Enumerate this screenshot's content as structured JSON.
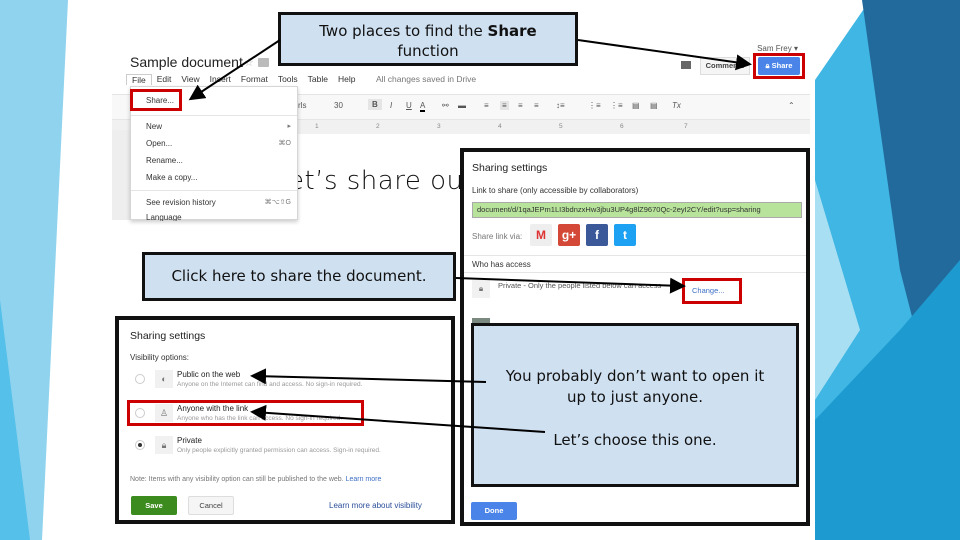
{
  "colors": {
    "callout_fill": "#cfe0f1",
    "highlight_red": "#cc0000",
    "share_blue": "#4a84e8",
    "save_green": "#3b8b1e",
    "link_field_green": "#b7e39a",
    "bg_light_blue": "#8fd3ee",
    "bg_mid_blue": "#3fb6e3",
    "bg_dark_blue": "#236a9c"
  },
  "callouts": {
    "top_line1_prefix": "Two places to find the ",
    "top_line1_bold": "Share",
    "top_line2": "function",
    "click_here": "Click here to share the document.",
    "right_line1": "You probably don’t want to open it",
    "right_line2": "up to just anyone.",
    "right_line3": "Let’s choose this one."
  },
  "gdoc": {
    "title": "Sample document",
    "user": "Sam Frey ▾",
    "menu": [
      "File",
      "Edit",
      "View",
      "Insert",
      "Format",
      "Tools",
      "Table",
      "Help"
    ],
    "saved_status": "All changes saved in Drive",
    "comments_label": "Comments",
    "share_label": "Share",
    "toolbar": {
      "font": "Girls",
      "size": "30",
      "bold": "B",
      "italic": "I",
      "underline": "U",
      "text_color": "A",
      "clear_format": "Tx",
      "collapse": "⌃"
    },
    "ruler_marks": [
      "1",
      "2",
      "3",
      "4",
      "5",
      "6",
      "7"
    ],
    "body_text": "et’s share ou"
  },
  "file_menu": {
    "items": [
      {
        "label": "Share...",
        "shortcut": ""
      },
      {
        "label": "New",
        "shortcut": "▸"
      },
      {
        "label": "Open...",
        "shortcut": "⌘O"
      },
      {
        "label": "Rename...",
        "shortcut": ""
      },
      {
        "label": "Make a copy...",
        "shortcut": ""
      },
      {
        "label": "See revision history",
        "shortcut": "⌘⌥⇧G"
      },
      {
        "label": "Language",
        "shortcut": "▸"
      }
    ]
  },
  "link_dialog": {
    "title": "Sharing settings",
    "link_label": "Link to share (only accessible by collaborators)",
    "link_value": "document/d/1qaJEPm1LI3bdnzxHw3jbu3UP4g8lZ9670Qc-2eyI2CY/edit?usp=sharing",
    "share_via_label": "Share link via:",
    "social": [
      {
        "name": "gmail",
        "glyph": "M",
        "color": "#ffffff",
        "text_color": "#d33"
      },
      {
        "name": "google-plus",
        "glyph": "g+",
        "color": "#d34836",
        "text_color": "#ffffff"
      },
      {
        "name": "facebook",
        "glyph": "f",
        "color": "#3b5998",
        "text_color": "#ffffff"
      },
      {
        "name": "twitter",
        "glyph": "t",
        "color": "#1da1f2",
        "text_color": "#ffffff"
      }
    ],
    "who_has_access": "Who has access",
    "private_desc": "Private - Only the people listed below can access",
    "change_link": "Change...",
    "done_label": "Done"
  },
  "visibility_dialog": {
    "title": "Sharing settings",
    "options_label": "Visibility options:",
    "options": [
      {
        "title": "Public on the web",
        "desc": "Anyone on the Internet can find and access. No sign-in required.",
        "icon": "globe",
        "checked": false
      },
      {
        "title": "Anyone with the link",
        "desc": "Anyone who has the link can access. No sign-in required.",
        "icon": "person",
        "checked": false
      },
      {
        "title": "Private",
        "desc": "Only people explicitly granted permission can access. Sign-in required.",
        "icon": "lock",
        "checked": true
      }
    ],
    "note": "Note: Items with any visibility option can still be published to the web.",
    "note_link": "Learn more",
    "save_label": "Save",
    "cancel_label": "Cancel",
    "learn_more_label": "Learn more about visibility"
  }
}
